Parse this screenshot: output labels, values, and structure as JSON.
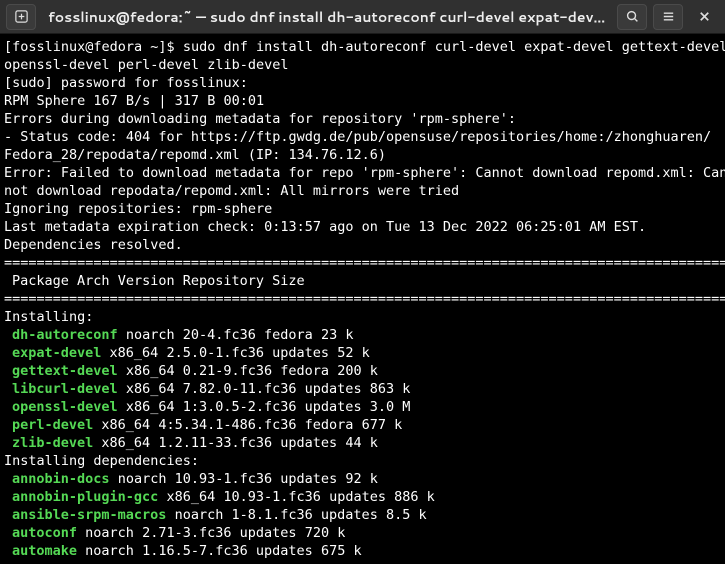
{
  "titlebar": {
    "title": "fosslinux@fedora:~ — sudo dnf install dh-autoreconf curl-devel expat-dev…"
  },
  "prompt": {
    "user_host": "[fosslinux@fedora ~]$ ",
    "command": "sudo dnf install dh-autoreconf curl-devel expat-devel gettext-devel",
    "command2": " openssl-devel perl-devel zlib-devel"
  },
  "lines": {
    "sudo": "[sudo] password for fosslinux:",
    "rpm_sphere": "RPM Sphere                                               167  B/s | 317  B     00:01",
    "err1": "Errors during downloading metadata for repository 'rpm-sphere':",
    "err2": "  - Status code: 404 for https://ftp.gwdg.de/pub/opensuse/repositories/home:/zhonghuaren/",
    "err3": "Fedora_28/repodata/repomd.xml (IP: 134.76.12.6)",
    "err4": "Error: Failed to download metadata for repo 'rpm-sphere': Cannot download repomd.xml: Can",
    "err5": "not download repodata/repomd.xml: All mirrors were tried",
    "ignore": "Ignoring repositories: rpm-sphere",
    "last_meta": "Last metadata expiration check: 0:13:57 ago on Tue 13 Dec 2022 06:25:01 AM EST.",
    "dep_resolved": "Dependencies resolved.",
    "hr": "========================================================================================================",
    "hdr_pkg": " Package",
    "hdr_arch": "Arch",
    "hdr_ver": "Version",
    "hdr_repo": "Repository",
    "hdr_size": "Size",
    "installing": "Installing:",
    "installing_deps": "Installing dependencies:"
  },
  "packages": [
    {
      "name": "dh-autoreconf",
      "arch": "noarch",
      "ver": "20-4.fc36",
      "repo": "fedora",
      "size": "23 k"
    },
    {
      "name": "expat-devel",
      "arch": "x86_64",
      "ver": "2.5.0-1.fc36",
      "repo": "updates",
      "size": "52 k"
    },
    {
      "name": "gettext-devel",
      "arch": "x86_64",
      "ver": "0.21-9.fc36",
      "repo": "fedora",
      "size": "200 k"
    },
    {
      "name": "libcurl-devel",
      "arch": "x86_64",
      "ver": "7.82.0-11.fc36",
      "repo": "updates",
      "size": "863 k"
    },
    {
      "name": "openssl-devel",
      "arch": "x86_64",
      "ver": "1:3.0.5-2.fc36",
      "repo": "updates",
      "size": "3.0 M"
    },
    {
      "name": "perl-devel",
      "arch": "x86_64",
      "ver": "4:5.34.1-486.fc36",
      "repo": "fedora",
      "size": "677 k"
    },
    {
      "name": "zlib-devel",
      "arch": "x86_64",
      "ver": "1.2.11-33.fc36",
      "repo": "updates",
      "size": "44 k"
    }
  ],
  "deps": [
    {
      "name": "annobin-docs",
      "arch": "noarch",
      "ver": "10.93-1.fc36",
      "repo": "updates",
      "size": "92 k"
    },
    {
      "name": "annobin-plugin-gcc",
      "arch": "x86_64",
      "ver": "10.93-1.fc36",
      "repo": "updates",
      "size": "886 k"
    },
    {
      "name": "ansible-srpm-macros",
      "arch": "noarch",
      "ver": "1-8.1.fc36",
      "repo": "updates",
      "size": "8.5 k"
    },
    {
      "name": "autoconf",
      "arch": "noarch",
      "ver": "2.71-3.fc36",
      "repo": "updates",
      "size": "720 k"
    },
    {
      "name": "automake",
      "arch": "noarch",
      "ver": "1.16.5-7.fc36",
      "repo": "updates",
      "size": "675 k"
    }
  ]
}
